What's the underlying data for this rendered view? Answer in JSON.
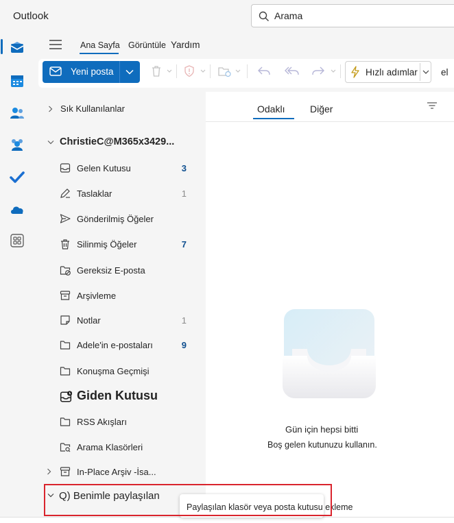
{
  "app": {
    "title": "Outlook"
  },
  "search": {
    "placeholder": "Arama"
  },
  "ribbon": {
    "tabs": [
      "Ana Sayfa",
      "Görüntüle",
      "Yardım"
    ],
    "new_mail_label": "Yeni posta",
    "quick_steps_label": "Hızlı adımlar",
    "overflow_label": "el"
  },
  "folders": {
    "favorites_label": "Sık Kullanılanlar",
    "account_label": "ChristieC@M365x3429...",
    "items": [
      {
        "label": "Gelen Kutusu",
        "count": "3",
        "icon": "inbox-icon"
      },
      {
        "label": "Taslaklar",
        "count": "1",
        "icon": "drafts-icon"
      },
      {
        "label": "Gönderilmiş Öğeler",
        "count": "",
        "icon": "sent-icon"
      },
      {
        "label": "Silinmiş Öğeler",
        "count": "7",
        "icon": "trash-icon"
      },
      {
        "label": "Gereksiz E-posta",
        "count": "",
        "icon": "junk-icon"
      },
      {
        "label": "Arşivleme",
        "count": "",
        "icon": "archive-icon"
      },
      {
        "label": "Notlar",
        "count": "1",
        "icon": "notes-icon"
      },
      {
        "label": "Adele'in e-postaları",
        "count": "9",
        "icon": "folder-icon"
      },
      {
        "label": "Konuşma Geçmişi",
        "count": "",
        "icon": "folder-icon"
      },
      {
        "label": "Giden Kutusu",
        "count": "",
        "icon": "outbox-icon"
      },
      {
        "label": "RSS Akışları",
        "count": "",
        "icon": "folder-icon"
      },
      {
        "label": "Arama Klasörleri",
        "count": "",
        "icon": "search-folder-icon"
      },
      {
        "label": "In-Place Arşiv -İsa...",
        "count": "",
        "icon": "archive-icon"
      }
    ],
    "shared_label": "Q) Benimle paylaşılan"
  },
  "message_list": {
    "tab_focused": "Odaklı",
    "tab_other": "Diğer",
    "empty_title": "Gün için hepsi bitti",
    "empty_subtitle": "Boş gelen kutunuzu kullanın."
  },
  "tooltip": {
    "text": "Paylaşılan klasör veya posta kutusu ekleme"
  },
  "colors": {
    "accent": "#0f6cbd",
    "highlight_box": "#d9242d"
  }
}
